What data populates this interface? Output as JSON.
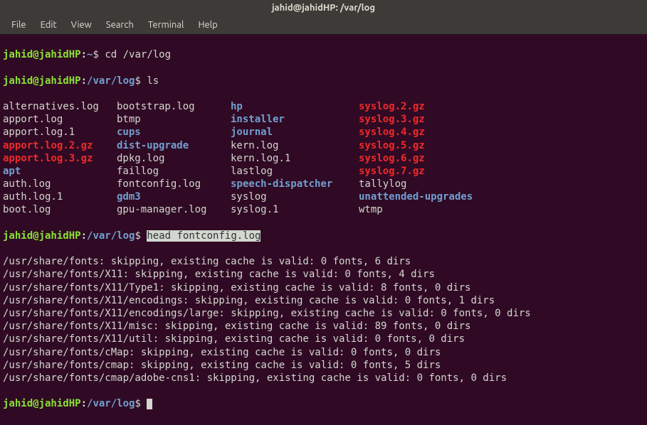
{
  "window": {
    "title": "jahid@jahidHP: /var/log"
  },
  "menu": {
    "file": "File",
    "edit": "Edit",
    "view": "View",
    "search": "Search",
    "terminal": "Terminal",
    "help": "Help"
  },
  "prompt": {
    "user_host": "jahid@jahidHP",
    "home_path": "~",
    "log_path": "/var/log",
    "dollar": "$ "
  },
  "commands": {
    "cd": "cd /var/log",
    "ls": "ls",
    "head": "head fontconfig.log"
  },
  "ls": {
    "rows": [
      [
        {
          "t": "alternatives.log",
          "c": "f-white"
        },
        {
          "t": "bootstrap.log",
          "c": "f-white"
        },
        {
          "t": "hp",
          "c": "f-blue"
        },
        {
          "t": "syslog.2.gz",
          "c": "f-red"
        }
      ],
      [
        {
          "t": "apport.log",
          "c": "f-white"
        },
        {
          "t": "btmp",
          "c": "f-white"
        },
        {
          "t": "installer",
          "c": "f-blue"
        },
        {
          "t": "syslog.3.gz",
          "c": "f-red"
        }
      ],
      [
        {
          "t": "apport.log.1",
          "c": "f-white"
        },
        {
          "t": "cups",
          "c": "f-blue"
        },
        {
          "t": "journal",
          "c": "f-blue"
        },
        {
          "t": "syslog.4.gz",
          "c": "f-red"
        }
      ],
      [
        {
          "t": "apport.log.2.gz",
          "c": "f-red"
        },
        {
          "t": "dist-upgrade",
          "c": "f-blue"
        },
        {
          "t": "kern.log",
          "c": "f-white"
        },
        {
          "t": "syslog.5.gz",
          "c": "f-red"
        }
      ],
      [
        {
          "t": "apport.log.3.gz",
          "c": "f-red"
        },
        {
          "t": "dpkg.log",
          "c": "f-white"
        },
        {
          "t": "kern.log.1",
          "c": "f-white"
        },
        {
          "t": "syslog.6.gz",
          "c": "f-red"
        }
      ],
      [
        {
          "t": "apt",
          "c": "f-blue"
        },
        {
          "t": "faillog",
          "c": "f-white"
        },
        {
          "t": "lastlog",
          "c": "f-white"
        },
        {
          "t": "syslog.7.gz",
          "c": "f-red"
        }
      ],
      [
        {
          "t": "auth.log",
          "c": "f-white"
        },
        {
          "t": "fontconfig.log",
          "c": "f-white"
        },
        {
          "t": "speech-dispatcher",
          "c": "f-blue"
        },
        {
          "t": "tallylog",
          "c": "f-white"
        }
      ],
      [
        {
          "t": "auth.log.1",
          "c": "f-white"
        },
        {
          "t": "gdm3",
          "c": "f-blue"
        },
        {
          "t": "syslog",
          "c": "f-white"
        },
        {
          "t": "unattended-upgrades",
          "c": "f-blue"
        }
      ],
      [
        {
          "t": "boot.log",
          "c": "f-white"
        },
        {
          "t": "gpu-manager.log",
          "c": "f-white"
        },
        {
          "t": "syslog.1",
          "c": "f-white"
        },
        {
          "t": "wtmp",
          "c": "f-white"
        }
      ]
    ]
  },
  "head_output": [
    "/usr/share/fonts: skipping, existing cache is valid: 0 fonts, 6 dirs",
    "/usr/share/fonts/X11: skipping, existing cache is valid: 0 fonts, 4 dirs",
    "/usr/share/fonts/X11/Type1: skipping, existing cache is valid: 8 fonts, 0 dirs",
    "/usr/share/fonts/X11/encodings: skipping, existing cache is valid: 0 fonts, 1 dirs",
    "/usr/share/fonts/X11/encodings/large: skipping, existing cache is valid: 0 fonts, 0 dirs",
    "/usr/share/fonts/X11/misc: skipping, existing cache is valid: 89 fonts, 0 dirs",
    "/usr/share/fonts/X11/util: skipping, existing cache is valid: 0 fonts, 0 dirs",
    "/usr/share/fonts/cMap: skipping, existing cache is valid: 0 fonts, 0 dirs",
    "/usr/share/fonts/cmap: skipping, existing cache is valid: 0 fonts, 5 dirs",
    "/usr/share/fonts/cmap/adobe-cns1: skipping, existing cache is valid: 0 fonts, 0 dirs"
  ]
}
